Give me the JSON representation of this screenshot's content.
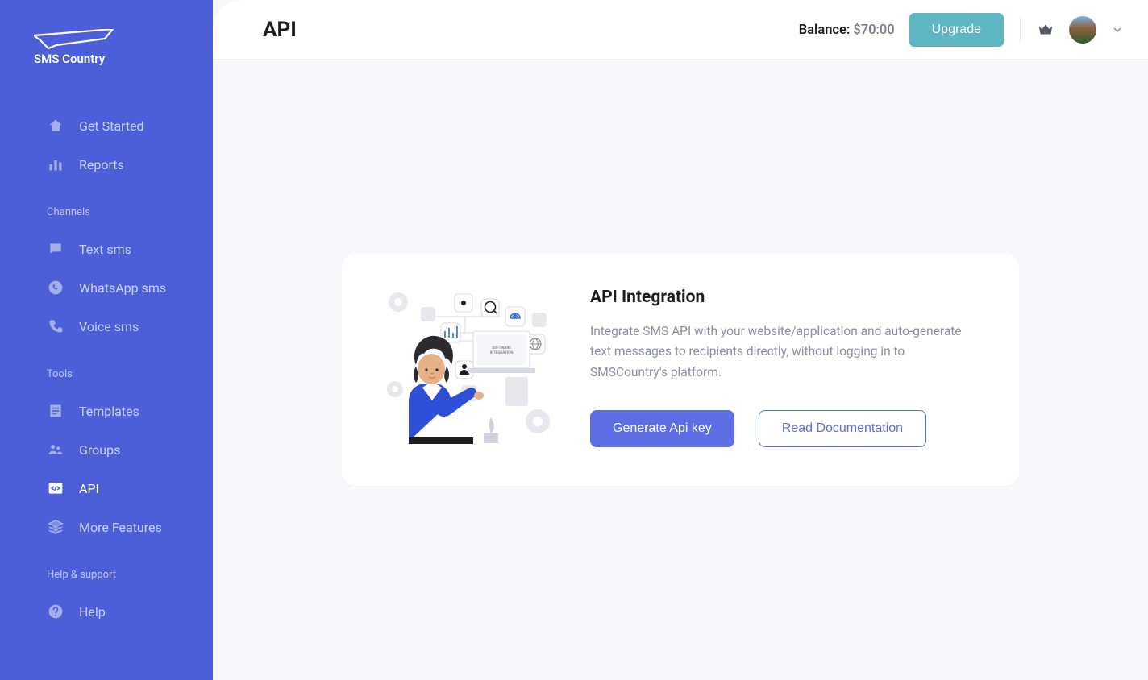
{
  "brand": "SMS Country",
  "header": {
    "title": "API",
    "balance_label": "Balance:",
    "balance_amount": "$70:00",
    "upgrade_label": "Upgrade"
  },
  "sidebar": {
    "items_main": [
      {
        "label": "Get Started",
        "icon": "home-icon"
      },
      {
        "label": "Reports",
        "icon": "chart-icon"
      }
    ],
    "section_channels_title": "Channels",
    "items_channels": [
      {
        "label": "Text sms",
        "icon": "chat-icon"
      },
      {
        "label": "WhatsApp sms",
        "icon": "whatsapp-icon"
      },
      {
        "label": "Voice sms",
        "icon": "phone-icon"
      }
    ],
    "section_tools_title": "Tools",
    "items_tools": [
      {
        "label": "Templates",
        "icon": "template-icon"
      },
      {
        "label": "Groups",
        "icon": "groups-icon"
      },
      {
        "label": "API",
        "icon": "code-icon",
        "active": true
      },
      {
        "label": "More Features",
        "icon": "layers-icon"
      }
    ],
    "section_help_title": "Help & support",
    "items_help": [
      {
        "label": "Help",
        "icon": "help-icon"
      }
    ]
  },
  "card": {
    "title": "API Integration",
    "description": "Integrate SMS API with your website/application and auto-generate text messages to recipients directly, without logging in to SMSCountry's platform.",
    "primary_button": "Generate Api key",
    "secondary_button": "Read Documentation",
    "illustration_caption": "SOFTWARE INTEGRATION"
  }
}
